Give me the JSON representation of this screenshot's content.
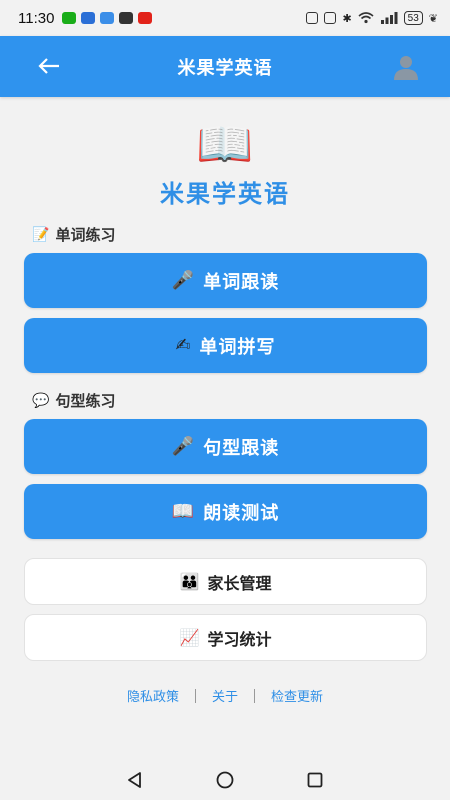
{
  "status_bar": {
    "time": "11:30",
    "battery": "53",
    "notif_colors": [
      "#1aad19",
      "#2b6fd6",
      "#3b8ee8",
      "#333333",
      "#e2231a"
    ]
  },
  "app_bar": {
    "title": "米果学英语",
    "back_icon": "arrow-left-icon",
    "avatar_icon": "user-avatar-icon"
  },
  "hero": {
    "icon": "📖",
    "title": "米果学英语"
  },
  "sections": {
    "word": {
      "icon": "📝",
      "label": "单词练习",
      "buttons": [
        {
          "icon": "🎤",
          "label": "单词跟读"
        },
        {
          "icon": "✍",
          "label": "单词拼写"
        }
      ]
    },
    "sentence": {
      "icon": "💬",
      "label": "句型练习",
      "buttons": [
        {
          "icon": "🎤",
          "label": "句型跟读"
        },
        {
          "icon": "📖",
          "label": "朗读测试"
        }
      ]
    }
  },
  "secondary": [
    {
      "icon": "👪",
      "label": "家长管理"
    },
    {
      "icon": "📈",
      "label": "学习统计"
    }
  ],
  "footer": {
    "privacy": "隐私政策",
    "about": "关于",
    "update": "检查更新"
  },
  "colors": {
    "primary": "#2f93ee",
    "title_blue": "#2f8fe6",
    "background": "#f2f2f2"
  }
}
